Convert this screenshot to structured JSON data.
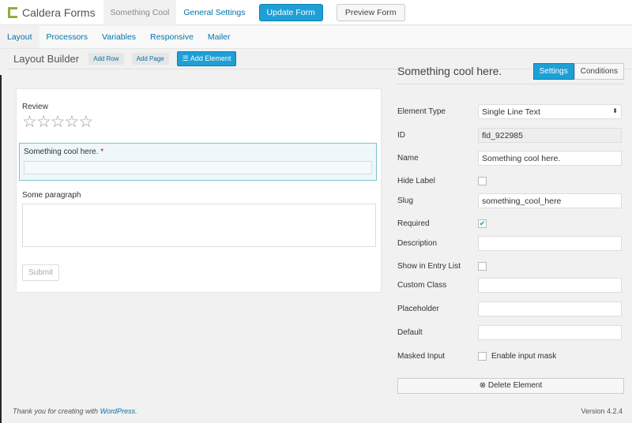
{
  "app": {
    "name": "Caldera Forms",
    "form_tab": "Something Cool",
    "general_settings": "General Settings",
    "update": "Update Form",
    "preview": "Preview Form"
  },
  "subnav": [
    "Layout",
    "Processors",
    "Variables",
    "Responsive",
    "Mailer"
  ],
  "builder": {
    "title": "Layout Builder",
    "add_row": "Add Row",
    "add_page": "Add Page",
    "add_element": "Add Element"
  },
  "form": {
    "review_label": "Review",
    "stars": 5,
    "field_label": "Something cool here.",
    "required_mark": "*",
    "paragraph_label": "Some paragraph",
    "submit": "Submit"
  },
  "panel": {
    "title": "Something cool here.",
    "tab_settings": "Settings",
    "tab_conditions": "Conditions",
    "element_type_label": "Element Type",
    "element_type": "Single Line Text",
    "id_label": "ID",
    "id": "fld_922985",
    "name_label": "Name",
    "name": "Something cool here.",
    "hide_label": "Hide Label",
    "hide_label_checked": false,
    "slug_label": "Slug",
    "slug": "something_cool_here",
    "required_label": "Required",
    "required_checked": true,
    "description_label": "Description",
    "description": "",
    "entry_list_label": "Show in Entry List",
    "entry_list_checked": false,
    "custom_class_label": "Custom Class",
    "custom_class": "",
    "placeholder_label": "Placeholder",
    "placeholder": "",
    "default_label": "Default",
    "default": "",
    "masked_label": "Masked Input",
    "masked_option": "Enable input mask",
    "masked_checked": false,
    "delete": "Delete Element"
  },
  "footer": {
    "thanks": "Thank you for creating with ",
    "wp": "WordPress",
    "dot": ".",
    "version": "Version 4.2.4"
  },
  "colors": {
    "accent": "#1e9fd6",
    "link": "#0073aa",
    "logo": "#8bb03f"
  }
}
